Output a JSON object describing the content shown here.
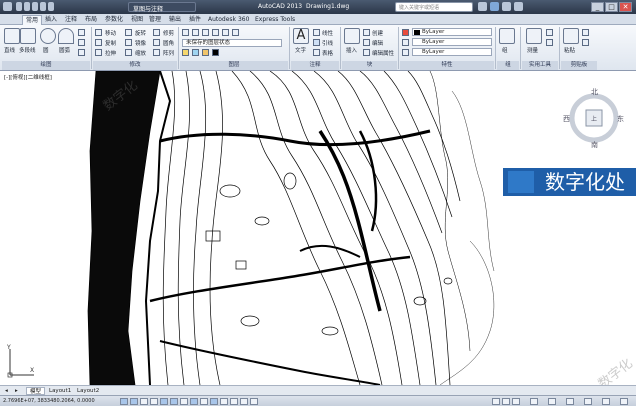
{
  "titlebar": {
    "app_title": "AutoCAD 2013",
    "doc_title": "Drawing1.dwg",
    "workspace": "草图与注释",
    "search_placeholder": "键入关键字或短语",
    "minimize": "_",
    "maximize": "□",
    "close": "✕"
  },
  "ribbon_tabs": [
    "常用",
    "插入",
    "注释",
    "布局",
    "参数化",
    "视图",
    "管理",
    "输出",
    "插件",
    "Autodesk 360",
    "Express Tools"
  ],
  "ribbon": {
    "draw_tools": [
      "直线",
      "多段线",
      "圆",
      "圆弧"
    ],
    "modify_tools": [
      "移动",
      "旋转",
      "修剪",
      "复制",
      "镜像",
      "圆角",
      "拉伸",
      "缩放",
      "阵列"
    ],
    "layer_current": "未保存的图层状态",
    "annotation_tools": [
      "文字",
      "线性",
      "引线",
      "表格"
    ],
    "block_tools": [
      "插入",
      "创建",
      "编辑",
      "编辑属性"
    ],
    "properties": {
      "color": "ByLayer",
      "linetype": "ByLayer",
      "lineweight": "ByLayer"
    },
    "group_tools": [
      "组"
    ],
    "utility_tools": [
      "测量"
    ],
    "clipboard_tools": [
      "粘贴"
    ],
    "panel_labels": [
      "绘图",
      "修改",
      "图层",
      "注释",
      "块",
      "特性",
      "组",
      "实用工具",
      "剪贴板"
    ]
  },
  "viewport": {
    "label": "[-][俯视][二维线框]"
  },
  "viewcube": {
    "north": "北",
    "south": "南",
    "east": "东",
    "west": "西",
    "top": "上"
  },
  "banner": {
    "text": "数字化处"
  },
  "watermark": "数字化",
  "layout_tabs": [
    "模型",
    "Layout1",
    "Layout2"
  ],
  "statusbar": {
    "coords": "2.7696E+07, 3833480.2064, 0.0000"
  },
  "colors": {
    "banner": "#1f5ea8",
    "ribbon_bg": "#e7ecf3",
    "titlebar": "#2b3648"
  }
}
